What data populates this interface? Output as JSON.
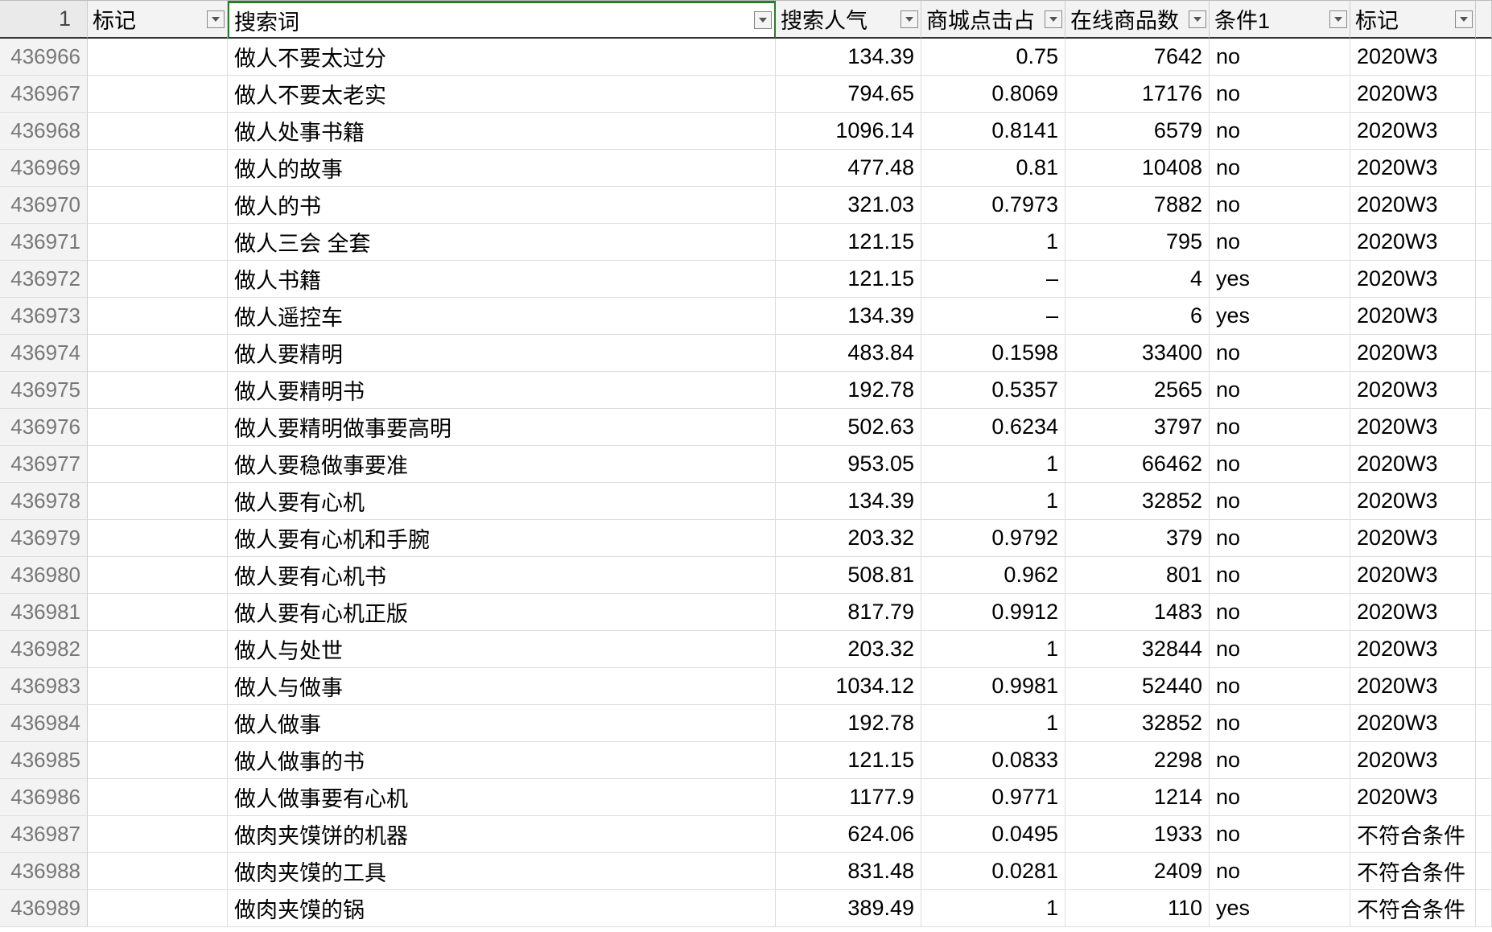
{
  "name_box": "1",
  "columns": [
    {
      "label": "标记",
      "filter": true,
      "align": "txt"
    },
    {
      "label": "搜索词",
      "filter": true,
      "align": "txt",
      "active": true
    },
    {
      "label": "搜索人气",
      "filter": true,
      "align": "num"
    },
    {
      "label": "商城点击占",
      "filter": true,
      "align": "num"
    },
    {
      "label": "在线商品数",
      "filter": true,
      "align": "num"
    },
    {
      "label": "条件1",
      "filter": true,
      "align": "txt"
    },
    {
      "label": "标记",
      "filter": true,
      "align": "txt"
    },
    {
      "label": "",
      "filter": false,
      "align": "txt"
    }
  ],
  "rows": [
    {
      "rn": "436966",
      "partial_top": true,
      "c": [
        "",
        "做人不要太过分",
        "134.39",
        "0.75",
        "7642",
        "no",
        "2020W3",
        ""
      ]
    },
    {
      "rn": "436967",
      "c": [
        "",
        "做人不要太老实",
        "794.65",
        "0.8069",
        "17176",
        "no",
        "2020W3",
        ""
      ]
    },
    {
      "rn": "436968",
      "c": [
        "",
        "做人处事书籍",
        "1096.14",
        "0.8141",
        "6579",
        "no",
        "2020W3",
        ""
      ]
    },
    {
      "rn": "436969",
      "c": [
        "",
        "做人的故事",
        "477.48",
        "0.81",
        "10408",
        "no",
        "2020W3",
        ""
      ]
    },
    {
      "rn": "436970",
      "c": [
        "",
        "做人的书",
        "321.03",
        "0.7973",
        "7882",
        "no",
        "2020W3",
        ""
      ]
    },
    {
      "rn": "436971",
      "c": [
        "",
        "做人三会 全套",
        "121.15",
        "1",
        "795",
        "no",
        "2020W3",
        ""
      ]
    },
    {
      "rn": "436972",
      "c": [
        "",
        "做人书籍",
        "121.15",
        "–",
        "4",
        "yes",
        "2020W3",
        ""
      ]
    },
    {
      "rn": "436973",
      "c": [
        "",
        "做人遥控车",
        "134.39",
        "–",
        "6",
        "yes",
        "2020W3",
        ""
      ]
    },
    {
      "rn": "436974",
      "c": [
        "",
        "做人要精明",
        "483.84",
        "0.1598",
        "33400",
        "no",
        "2020W3",
        ""
      ]
    },
    {
      "rn": "436975",
      "c": [
        "",
        "做人要精明书",
        "192.78",
        "0.5357",
        "2565",
        "no",
        "2020W3",
        ""
      ]
    },
    {
      "rn": "436976",
      "c": [
        "",
        "做人要精明做事要高明",
        "502.63",
        "0.6234",
        "3797",
        "no",
        "2020W3",
        ""
      ]
    },
    {
      "rn": "436977",
      "c": [
        "",
        "做人要稳做事要准",
        "953.05",
        "1",
        "66462",
        "no",
        "2020W3",
        ""
      ]
    },
    {
      "rn": "436978",
      "c": [
        "",
        "做人要有心机",
        "134.39",
        "1",
        "32852",
        "no",
        "2020W3",
        ""
      ]
    },
    {
      "rn": "436979",
      "c": [
        "",
        "做人要有心机和手腕",
        "203.32",
        "0.9792",
        "379",
        "no",
        "2020W3",
        ""
      ]
    },
    {
      "rn": "436980",
      "c": [
        "",
        "做人要有心机书",
        "508.81",
        "0.962",
        "801",
        "no",
        "2020W3",
        ""
      ]
    },
    {
      "rn": "436981",
      "c": [
        "",
        "做人要有心机正版",
        "817.79",
        "0.9912",
        "1483",
        "no",
        "2020W3",
        ""
      ]
    },
    {
      "rn": "436982",
      "c": [
        "",
        "做人与处世",
        "203.32",
        "1",
        "32844",
        "no",
        "2020W3",
        ""
      ]
    },
    {
      "rn": "436983",
      "c": [
        "",
        "做人与做事",
        "1034.12",
        "0.9981",
        "52440",
        "no",
        "2020W3",
        ""
      ]
    },
    {
      "rn": "436984",
      "c": [
        "",
        "做人做事",
        "192.78",
        "1",
        "32852",
        "no",
        "2020W3",
        ""
      ]
    },
    {
      "rn": "436985",
      "c": [
        "",
        "做人做事的书",
        "121.15",
        "0.0833",
        "2298",
        "no",
        "2020W3",
        ""
      ]
    },
    {
      "rn": "436986",
      "c": [
        "",
        "做人做事要有心机",
        "1177.9",
        "0.9771",
        "1214",
        "no",
        "2020W3",
        ""
      ]
    },
    {
      "rn": "436987",
      "c": [
        "",
        "做肉夹馍饼的机器",
        "624.06",
        "0.0495",
        "1933",
        "no",
        "不符合条件",
        ""
      ]
    },
    {
      "rn": "436988",
      "c": [
        "",
        "做肉夹馍的工具",
        "831.48",
        "0.0281",
        "2409",
        "no",
        "不符合条件",
        ""
      ]
    },
    {
      "rn": "436989",
      "c": [
        "",
        "做肉夹馍的锅",
        "389.49",
        "1",
        "110",
        "yes",
        "不符合条件",
        ""
      ]
    }
  ]
}
